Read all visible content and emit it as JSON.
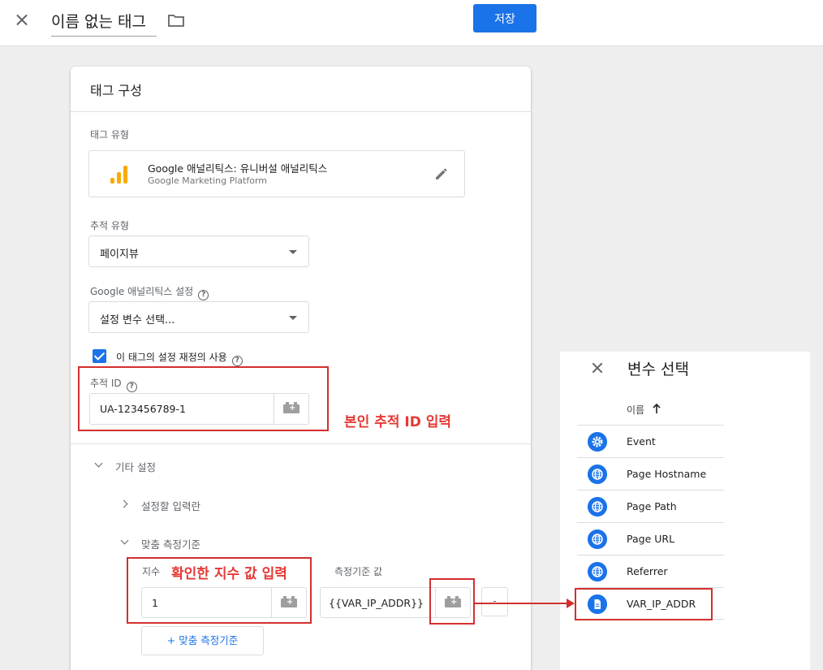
{
  "topbar": {
    "tag_name": "이름 없는 태그",
    "save_label": "저장"
  },
  "config": {
    "title": "태그 구성",
    "tag_type_label": "태그 유형",
    "tag_type_name": "Google 애널리틱스: 유니버설 애널리틱스",
    "tag_type_sub": "Google Marketing Platform",
    "track_type_label": "추적 유형",
    "track_type_value": "페이지뷰",
    "ga_settings_label": "Google 애널리틱스 설정",
    "ga_settings_value": "설정 변수 선택...",
    "override_label": "이 태그의 설정 재정의 사용",
    "tracking_id_label": "추적 ID",
    "tracking_id_value": "UA-123456789-1",
    "more_settings_label": "기타 설정",
    "fields_label": "설정할 입력란",
    "custom_dims_label": "맞춤 측정기준",
    "index_label": "지수",
    "dim_value_label": "측정기준 값",
    "index_value": "1",
    "dim_value": "{{VAR_IP_ADDR}}",
    "minus_label": "-",
    "add_dim_label": "+ 맞춤 측정기준",
    "help_glyph": "?",
    "brick_glyph": "+"
  },
  "annotations": {
    "tracking_id_note": "본인 추적 ID 입력",
    "index_note": "확인한 지수 값 입력"
  },
  "panel": {
    "title": "변수 선택",
    "col_header": "이름",
    "variables": [
      {
        "name": "Event",
        "icon": "gear-icon"
      },
      {
        "name": "Page Hostname",
        "icon": "globe-icon"
      },
      {
        "name": "Page Path",
        "icon": "globe-icon"
      },
      {
        "name": "Page URL",
        "icon": "globe-icon"
      },
      {
        "name": "Referrer",
        "icon": "globe-icon"
      },
      {
        "name": "VAR_IP_ADDR",
        "icon": "document-icon"
      }
    ]
  },
  "colors": {
    "accent": "#1a73e8",
    "annotation": "#e53935",
    "ga_logo": "#f9ab00"
  }
}
